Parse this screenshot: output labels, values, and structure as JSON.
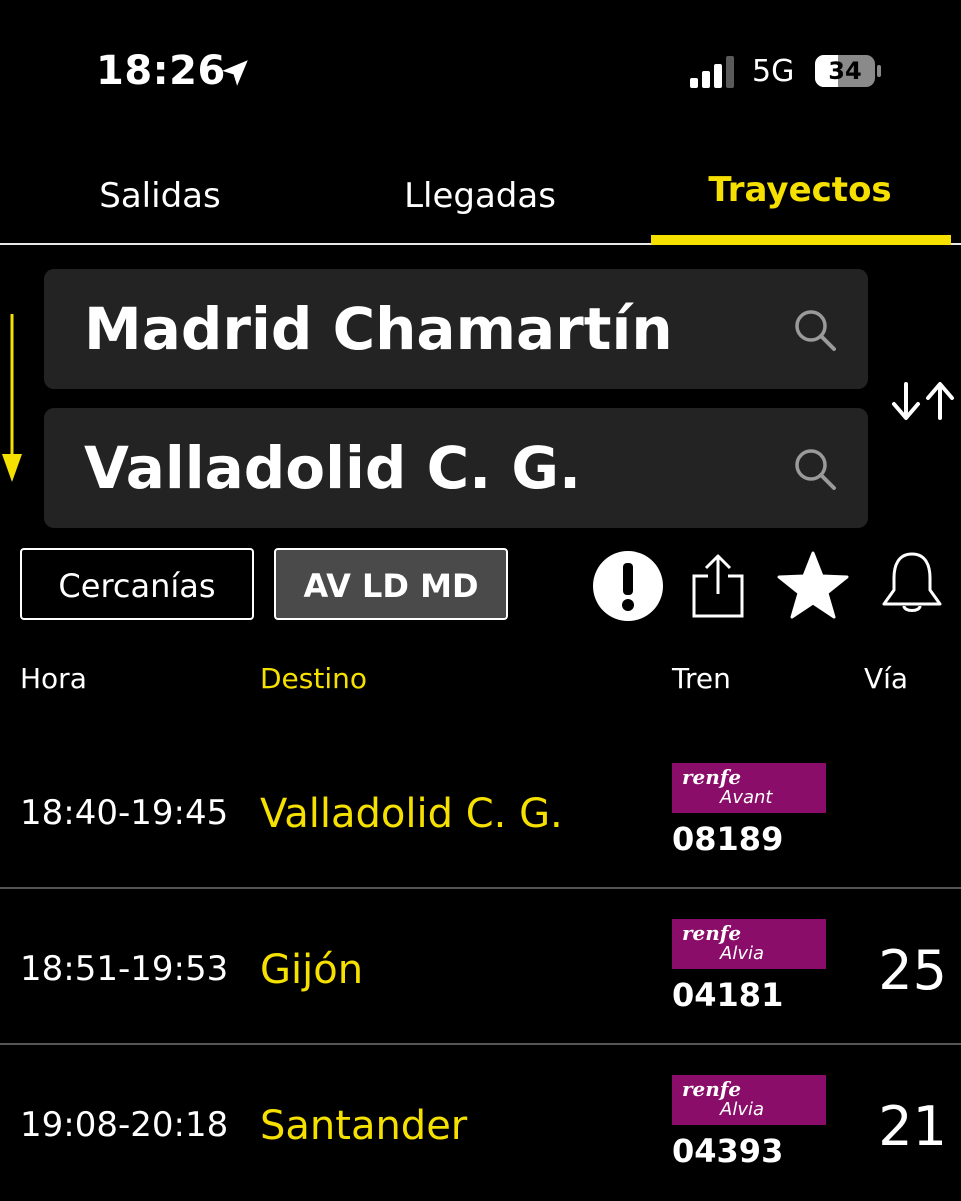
{
  "status_bar": {
    "time": "18:26",
    "location_icon": "location-arrow-icon",
    "signal_icon": "cellular-signal-icon",
    "network": "5G",
    "battery": "34",
    "battery_icon": "battery-icon"
  },
  "tabs": [
    {
      "label": "Salidas",
      "active": false
    },
    {
      "label": "Llegadas",
      "active": false
    },
    {
      "label": "Trayectos",
      "active": true
    }
  ],
  "route": {
    "origin": "Madrid Chamartín",
    "destination": "Valladolid C. G.",
    "search_icon": "search-icon",
    "swap_icon": "swap-arrows-icon",
    "direction_icon": "arrow-down-icon"
  },
  "filters": {
    "cercanias": "Cercanías",
    "av_ld_md": "AV LD MD",
    "selected": "AV LD MD"
  },
  "actions": {
    "alert_icon": "alert-icon",
    "share_icon": "share-icon",
    "favorite_icon": "star-icon",
    "notify_icon": "bell-icon"
  },
  "table": {
    "headers": {
      "hora": "Hora",
      "destino": "Destino",
      "tren": "Tren",
      "via": "Vía"
    },
    "rows": [
      {
        "hora": "18:40-19:45",
        "destino": "Valladolid C. G.",
        "brand": "renfe",
        "product": "Avant",
        "tren": "08189",
        "via": ""
      },
      {
        "hora": "18:51-19:53",
        "destino": "Gijón",
        "brand": "renfe",
        "product": "Alvia",
        "tren": "04181",
        "via": "25"
      },
      {
        "hora": "19:08-20:18",
        "destino": "Santander",
        "brand": "renfe",
        "product": "Alvia",
        "tren": "04393",
        "via": "21"
      }
    ]
  },
  "colors": {
    "accent": "#f5e000",
    "background": "#000000",
    "field_bg": "#232323",
    "renfe_badge": "#8a0e69",
    "selected_filter": "#4a4a4a"
  }
}
